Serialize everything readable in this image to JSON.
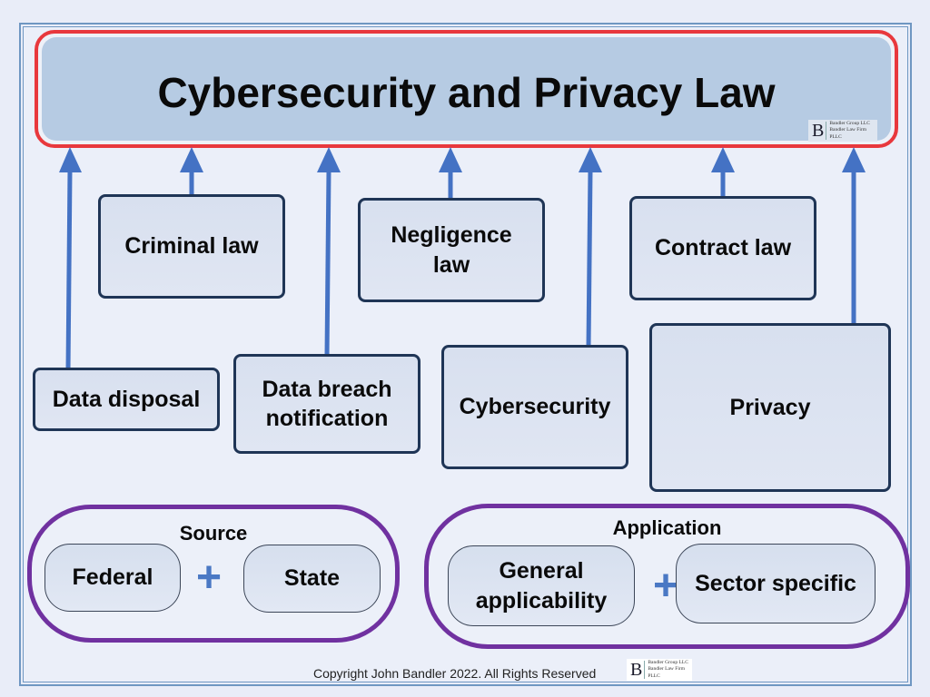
{
  "title": "Cybersecurity and Privacy Law",
  "logo": {
    "letter": "B",
    "line1": "Bandler Group LLC",
    "line2": "Bandler Law Firm PLLC"
  },
  "upper_boxes": [
    {
      "id": "criminal",
      "label": "Criminal law"
    },
    {
      "id": "negligence",
      "label": "Negligence\nlaw"
    },
    {
      "id": "contract",
      "label": "Contract law"
    }
  ],
  "lower_boxes": [
    {
      "id": "disposal",
      "label": "Data disposal"
    },
    {
      "id": "breach",
      "label": "Data breach\nnotification"
    },
    {
      "id": "cyber",
      "label": "Cybersecurity"
    },
    {
      "id": "privacy",
      "label": "Privacy"
    }
  ],
  "groups": {
    "source": {
      "title": "Source",
      "items": [
        "Federal",
        "State"
      ],
      "operator": "+"
    },
    "application": {
      "title": "Application",
      "items": [
        "General\napplicability",
        "Sector specific"
      ],
      "operator": "+"
    }
  },
  "footer": {
    "copyright": "Copyright John Bandler 2022. All Rights Reserved"
  },
  "colors": {
    "title_border": "#e8383d",
    "title_fill": "#b6cbe3",
    "arrow": "#4472c4",
    "box_border": "#1f3556",
    "group_border": "#7031a0"
  }
}
